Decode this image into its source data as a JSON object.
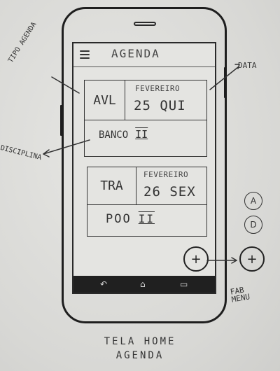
{
  "app": {
    "title": "AGENDA"
  },
  "cards": [
    {
      "type": "AVL",
      "month": "FEVEREIRO",
      "day": "25 QUI",
      "subject": "BANCO",
      "roman": "II"
    },
    {
      "type": "TRA",
      "month": "FEVEREIRO",
      "day": "26 SEX",
      "subject": "POO",
      "roman": "II"
    }
  ],
  "fab": {
    "label": "+"
  },
  "fab_menu": {
    "label": "+",
    "items": [
      "A",
      "D"
    ]
  },
  "annotations": {
    "tipo_agenda": "TIPO AGENDA",
    "data": "DATA",
    "disciplina": "DISCIPLINA",
    "fab_menu": "FAB MENU"
  },
  "caption": {
    "line1": "TELA HOME",
    "line2": "AGENDA"
  }
}
